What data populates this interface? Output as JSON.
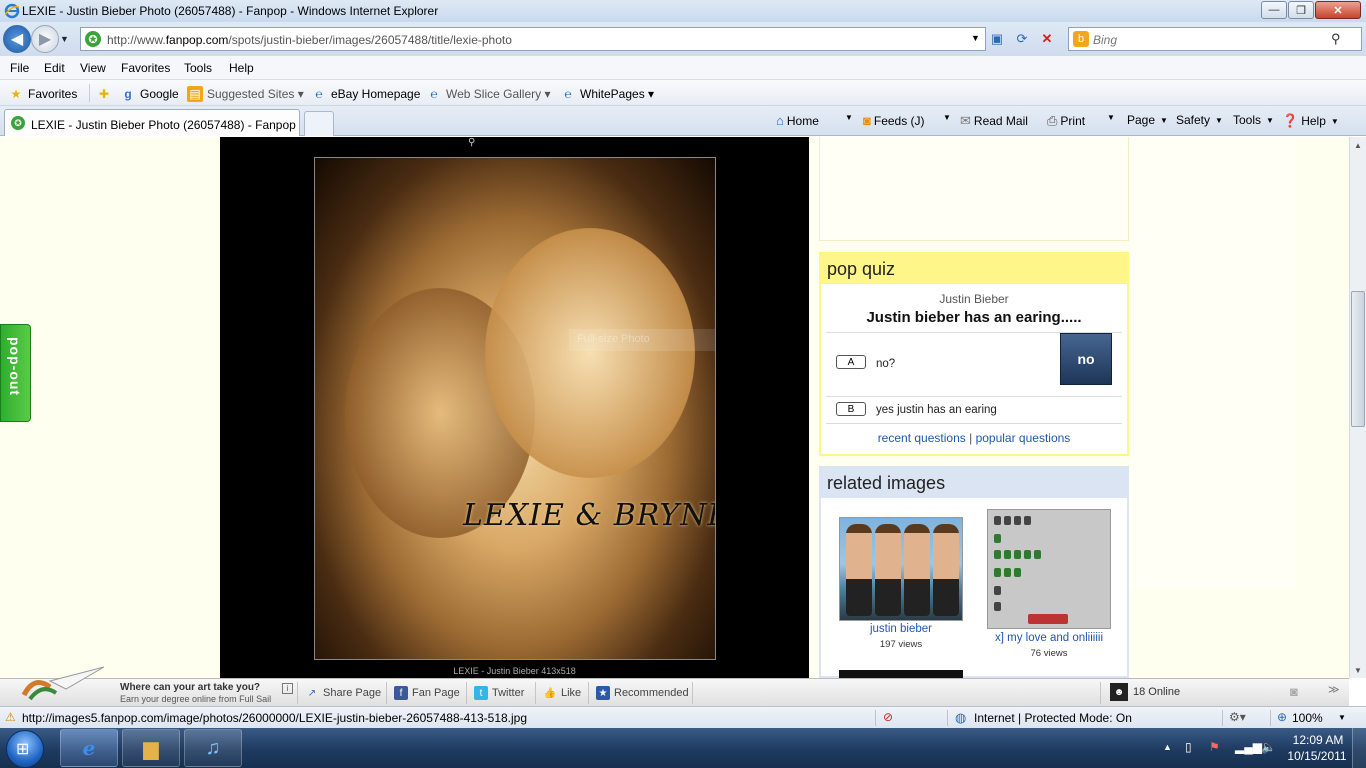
{
  "window": {
    "title": "LEXIE - Justin Bieber Photo (26057488) - Fanpop - Windows Internet Explorer",
    "min_glyph": "—",
    "max_glyph": "❐",
    "close_glyph": "✕"
  },
  "address": {
    "url_prefix": "http://www.",
    "url_domain": "fanpop.com",
    "url_path": "/spots/justin-bieber/images/26057488/title/lexie-photo",
    "search_placeholder": "Bing"
  },
  "menu": [
    "File",
    "Edit",
    "View",
    "Favorites",
    "Tools",
    "Help"
  ],
  "favorites_bar": {
    "favorites": "Favorites",
    "items": [
      "Google",
      "Suggested Sites ▾",
      "eBay Homepage",
      "Web Slice Gallery ▾",
      "WhitePages ▾"
    ]
  },
  "tab": {
    "title": "LEXIE - Justin Bieber Photo (26057488) - Fanpop"
  },
  "commands": {
    "home": "Home",
    "feeds": "Feeds (J)",
    "read_mail": "Read Mail",
    "print": "Print",
    "page": "Page",
    "safety": "Safety",
    "tools": "Tools",
    "help": "Help"
  },
  "photo": {
    "overlay_text": "Full-size Photo",
    "caption_art": "LEXIE & BRYNLEE",
    "meta": "LEXIE - Justin Bieber 413x518"
  },
  "popout": {
    "label": "pop-out"
  },
  "pop_quiz": {
    "header": "pop quiz",
    "topic": "Justin Bieber",
    "question": "Justin bieber has an earing.....",
    "answers": [
      {
        "letter": "A",
        "text": "no?"
      },
      {
        "letter": "B",
        "text": "yes justin has an earing"
      }
    ],
    "selected": "no",
    "links": {
      "recent": "recent questions",
      "separator": "|",
      "popular": "popular questions"
    }
  },
  "related_images": {
    "header": "related images",
    "items": [
      {
        "title": "justin bieber",
        "views": "197 views"
      },
      {
        "title": "x] my love and onliiiiii",
        "views": "76 views"
      }
    ]
  },
  "fanpop_bar": {
    "ad_title": "Where can your art take you?",
    "ad_sub": "Earn your degree online from Full Sail",
    "ad_info": "i",
    "share": "Share Page",
    "fan_page": "Fan Page",
    "twitter": "Twitter",
    "like": "Like",
    "recommended": "Recommended",
    "online": "18 Online"
  },
  "status": {
    "url": "http://images5.fanpop.com/image/photos/26000000/LEXIE-justin-bieber-26057488-413-518.jpg",
    "zone": "Internet | Protected Mode: On",
    "zoom": "100%"
  },
  "taskbar": {
    "time": "12:09 AM",
    "date": "10/15/2011"
  },
  "colors": {
    "quiz_header": "#fff68a",
    "related_header": "#dbe4f2",
    "link_blue": "#2157b0",
    "popout_green": "#3cb33c"
  }
}
